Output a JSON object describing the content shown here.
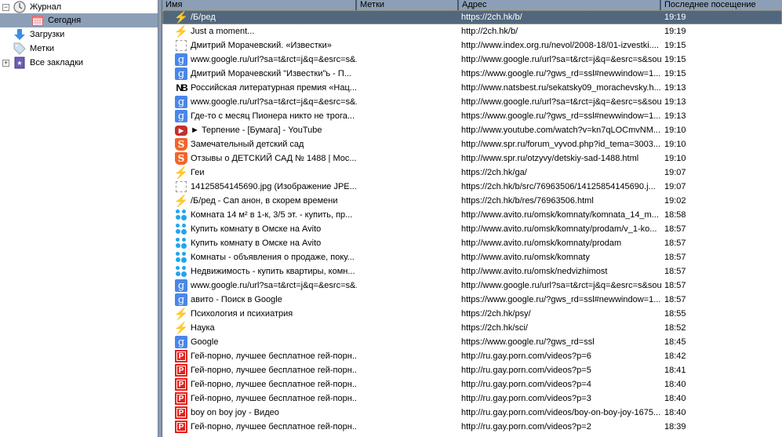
{
  "sidebar": {
    "items": [
      {
        "label": "Журнал",
        "icon": "clock-icon",
        "expander": "−"
      },
      {
        "label": "Сегодня",
        "icon": "calendar-icon",
        "selected": true
      },
      {
        "label": "Загрузки",
        "icon": "download-arrow-icon"
      },
      {
        "label": "Метки",
        "icon": "tag-icon"
      },
      {
        "label": "Все закладки",
        "icon": "bookmarks-book-icon",
        "expander": "+"
      }
    ]
  },
  "table": {
    "columns": [
      "Имя",
      "Метки",
      "Адрес",
      "Последнее посещение"
    ],
    "rows": [
      {
        "icon": "bolt",
        "name": "/Б/ред",
        "url": "https://2ch.hk/b/",
        "time": "19:19",
        "selected": true
      },
      {
        "icon": "bolt",
        "name": "Just a moment...",
        "url": "http://2ch.hk/b/",
        "time": "19:19"
      },
      {
        "icon": "blank",
        "name": "Дмитрий Морачевский. «Известки»",
        "url": "http://www.index.org.ru/nevol/2008-18/01-izvestki....",
        "time": "19:15"
      },
      {
        "icon": "google",
        "name": "www.google.ru/url?sa=t&rct=j&q=&esrc=s&...",
        "url": "http://www.google.ru/url?sa=t&rct=j&q=&esrc=s&sou...",
        "time": "19:15"
      },
      {
        "icon": "google",
        "name": "Дмитрий Морачевский \"Известки\"ь - П...",
        "url": "https://www.google.ru/?gws_rd=ssl#newwindow=1...",
        "time": "19:15"
      },
      {
        "icon": "nb",
        "name": "Российская литературная премия «Нац...",
        "url": "http://www.natsbest.ru/sekatsky09_morachevsky.h...",
        "time": "19:13"
      },
      {
        "icon": "google",
        "name": "www.google.ru/url?sa=t&rct=j&q=&esrc=s&...",
        "url": "http://www.google.ru/url?sa=t&rct=j&q=&esrc=s&sou...",
        "time": "19:13"
      },
      {
        "icon": "google",
        "name": "Где-то с месяц Пионера никто не трога...",
        "url": "https://www.google.ru/?gws_rd=ssl#newwindow=1...",
        "time": "19:13"
      },
      {
        "icon": "youtube",
        "name": "► Терпение - [Бумага] - YouTube",
        "url": "http://www.youtube.com/watch?v=kn7qLOCmvNM...",
        "time": "19:10"
      },
      {
        "icon": "spr",
        "name": "Замечательный детский сад",
        "url": "http://www.spr.ru/forum_vyvod.php?id_tema=3003...",
        "time": "19:10"
      },
      {
        "icon": "spr",
        "name": "Отзывы о ДЕТСКИЙ САД № 1488 | Мос...",
        "url": "http://www.spr.ru/otzyvy/detskiy-sad-1488.html",
        "time": "19:10"
      },
      {
        "icon": "bolt",
        "name": "Геи",
        "url": "https://2ch.hk/ga/",
        "time": "19:07"
      },
      {
        "icon": "blank",
        "name": "14125854145690.jpg (Изображение JPE...",
        "url": "https://2ch.hk/b/src/76963506/14125854145690.j...",
        "time": "19:07"
      },
      {
        "icon": "bolt",
        "name": "/Б/ред - Сап анон, в скорем времени",
        "url": "https://2ch.hk/b/res/76963506.html",
        "time": "19:02"
      },
      {
        "icon": "avito",
        "name": "Комната 14 м² в 1-к, 3/5 эт. - купить, пр...",
        "url": "http://www.avito.ru/omsk/komnaty/komnata_14_m...",
        "time": "18:58"
      },
      {
        "icon": "avito",
        "name": "Купить комнату в Омске на Avito",
        "url": "http://www.avito.ru/omsk/komnaty/prodam/v_1-ko...",
        "time": "18:57"
      },
      {
        "icon": "avito",
        "name": "Купить комнату в Омске на Avito",
        "url": "http://www.avito.ru/omsk/komnaty/prodam",
        "time": "18:57"
      },
      {
        "icon": "avito",
        "name": "Комнаты - объявления о продаже, поку...",
        "url": "http://www.avito.ru/omsk/komnaty",
        "time": "18:57"
      },
      {
        "icon": "avito",
        "name": "Недвижимость - купить квартиры, комн...",
        "url": "http://www.avito.ru/omsk/nedvizhimost",
        "time": "18:57"
      },
      {
        "icon": "google",
        "name": "www.google.ru/url?sa=t&rct=j&q=&esrc=s&...",
        "url": "http://www.google.ru/url?sa=t&rct=j&q=&esrc=s&sou...",
        "time": "18:57"
      },
      {
        "icon": "google",
        "name": "авито - Поиск в Google",
        "url": "https://www.google.ru/?gws_rd=ssl#newwindow=1...",
        "time": "18:57"
      },
      {
        "icon": "bolt",
        "name": "Психология и психиатрия",
        "url": "https://2ch.hk/psy/",
        "time": "18:55"
      },
      {
        "icon": "bolt",
        "name": "Наука",
        "url": "https://2ch.hk/sci/",
        "time": "18:52"
      },
      {
        "icon": "google",
        "name": "Google",
        "url": "https://www.google.ru/?gws_rd=ssl",
        "time": "18:45"
      },
      {
        "icon": "p",
        "name": "Гей-порно, лучшее бесплатное гей-порн...",
        "url": "http://ru.gay.porn.com/videos?p=6",
        "time": "18:42"
      },
      {
        "icon": "p",
        "name": "Гей-порно, лучшее бесплатное гей-порн...",
        "url": "http://ru.gay.porn.com/videos?p=5",
        "time": "18:41"
      },
      {
        "icon": "p",
        "name": "Гей-порно, лучшее бесплатное гей-порн...",
        "url": "http://ru.gay.porn.com/videos?p=4",
        "time": "18:40"
      },
      {
        "icon": "p",
        "name": "Гей-порно, лучшее бесплатное гей-порн...",
        "url": "http://ru.gay.porn.com/videos?p=3",
        "time": "18:40"
      },
      {
        "icon": "p",
        "name": "boy on boy joy - Видео",
        "url": "http://ru.gay.porn.com/videos/boy-on-boy-joy-1675...",
        "time": "18:40"
      },
      {
        "icon": "p",
        "name": "Гей-порно, лучшее бесплатное гей-порн...",
        "url": "http://ru.gay.porn.com/videos?p=2",
        "time": "18:39"
      }
    ]
  },
  "colors": {
    "header": "#8c9fb6",
    "selected_row": "#52677e",
    "sidebar_selected": "#8c9fb6"
  }
}
